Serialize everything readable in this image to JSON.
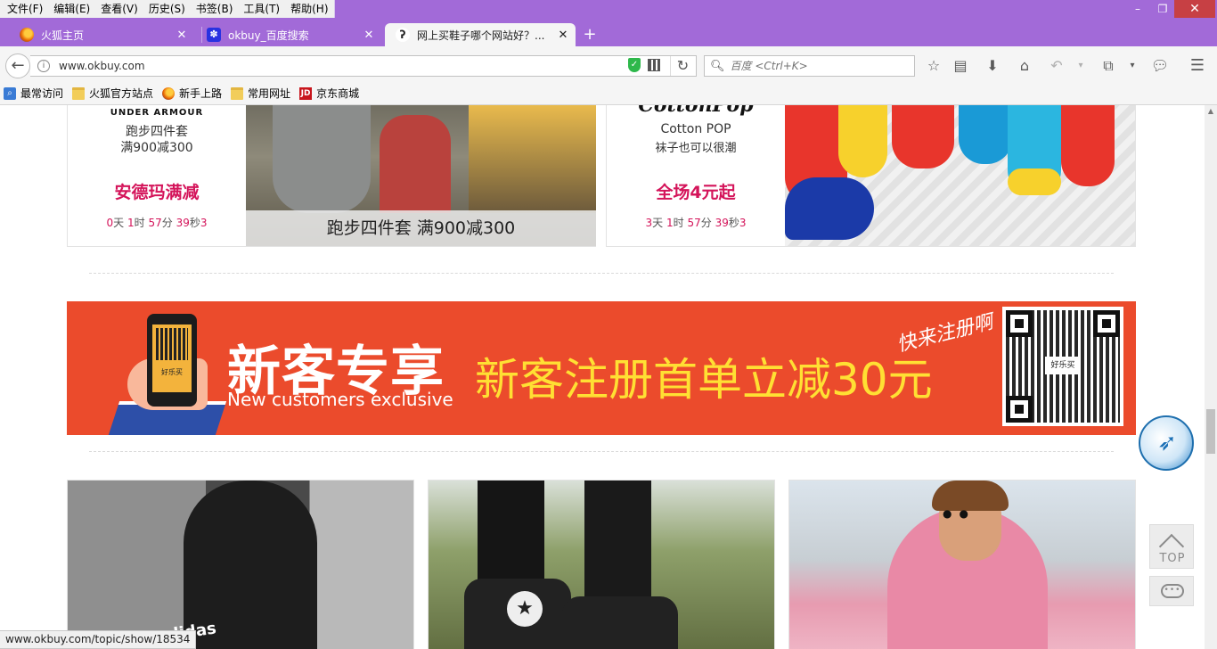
{
  "menubar": {
    "items": [
      "文件(F)",
      "编辑(E)",
      "查看(V)",
      "历史(S)",
      "书签(B)",
      "工具(T)",
      "帮助(H)"
    ]
  },
  "window_controls": {
    "minimize": "–",
    "maximize": "❐",
    "close": "✕"
  },
  "tabs": [
    {
      "label": "火狐主页",
      "icon": "firefox-icon"
    },
    {
      "label": "okbuy_百度搜索",
      "icon": "baidu-paw-icon"
    },
    {
      "label": "网上买鞋子哪个网站好？...",
      "icon": "okbuy-icon",
      "active": true
    }
  ],
  "new_tab_label": "+",
  "navbar": {
    "url": "www.okbuy.com",
    "search_placeholder": "百度 <Ctrl+K>"
  },
  "bookmarks": [
    {
      "label": "最常访问",
      "icon": "most-visited-icon"
    },
    {
      "label": "火狐官方站点",
      "icon": "folder-icon"
    },
    {
      "label": "新手上路",
      "icon": "firefox-icon"
    },
    {
      "label": "常用网址",
      "icon": "folder-icon"
    },
    {
      "label": "京东商城",
      "icon": "jd-icon"
    }
  ],
  "promos": [
    {
      "brand": "UNDER ARMOUR",
      "line1": "跑步四件套",
      "line2": "满900减300",
      "title": "安德玛满减",
      "timer": {
        "days": "0",
        "d_unit": "天",
        "hours": "1",
        "h_unit": "时",
        "minutes": "57",
        "m_unit": "分",
        "seconds": "39",
        "s_unit": "秒",
        "tenths": "3"
      },
      "image_caption": "跑步四件套  满900减300"
    },
    {
      "brand": "CottonPop",
      "line1": "Cotton POP",
      "line2": "袜子也可以很潮",
      "title": "全场4元起",
      "timer": {
        "days": "3",
        "d_unit": "天",
        "hours": "1",
        "h_unit": "时",
        "minutes": "57",
        "m_unit": "分",
        "seconds": "39",
        "s_unit": "秒",
        "tenths": "3"
      }
    }
  ],
  "banner": {
    "title": "新客专享",
    "subtitle": "New customers exclusive",
    "offer": "新客注册首单立减30元",
    "script_text": "快来注册啊",
    "phone_logo": "好乐买",
    "qr_logo": "好乐买",
    "colors": {
      "background": "#eb4b2c",
      "offer": "#ffe033"
    }
  },
  "photos": {
    "bag_brand": "adidas",
    "shoe_patch": "★"
  },
  "floating": {
    "top_label": "TOP",
    "chat_label": "•••"
  },
  "status_url": "www.okbuy.com/topic/show/18534",
  "colors": {
    "titlebar": "#a26ad8",
    "accent_red": "#d4145a"
  }
}
